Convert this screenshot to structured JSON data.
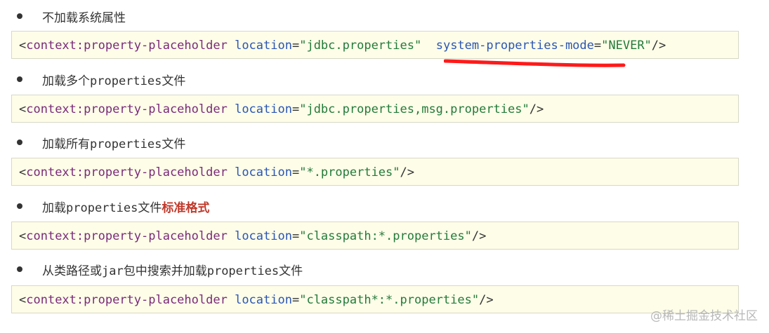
{
  "items": [
    {
      "bullet_parts": [
        {
          "text": "不加载系统属性",
          "mono": false
        }
      ],
      "code": {
        "open": "<",
        "tag": "context:property-placeholder",
        "attrs": [
          {
            "name": "location",
            "value": "\"jdbc.properties\""
          },
          {
            "name": "system-properties-mode",
            "value": "\"NEVER\""
          }
        ],
        "close": "/>"
      }
    },
    {
      "bullet_parts": [
        {
          "text": "加载多个",
          "mono": false
        },
        {
          "text": "properties",
          "mono": true
        },
        {
          "text": "文件",
          "mono": false
        }
      ],
      "code": {
        "open": "<",
        "tag": "context:property-placeholder",
        "attrs": [
          {
            "name": "location",
            "value": "\"jdbc.properties,msg.properties\""
          }
        ],
        "close": "/>"
      }
    },
    {
      "bullet_parts": [
        {
          "text": "加载所有",
          "mono": false
        },
        {
          "text": "properties",
          "mono": true
        },
        {
          "text": "文件",
          "mono": false
        }
      ],
      "code": {
        "open": "<",
        "tag": "context:property-placeholder",
        "attrs": [
          {
            "name": "location",
            "value": "\"*.properties\""
          }
        ],
        "close": "/>"
      }
    },
    {
      "bullet_parts": [
        {
          "text": "加载",
          "mono": false
        },
        {
          "text": "properties",
          "mono": true
        },
        {
          "text": "文件",
          "mono": false
        },
        {
          "text": "标准格式",
          "mono": false,
          "highlight": true
        }
      ],
      "code": {
        "open": "<",
        "tag": "context:property-placeholder",
        "attrs": [
          {
            "name": "location",
            "value": "\"classpath:*.properties\""
          }
        ],
        "close": "/>"
      }
    },
    {
      "bullet_parts": [
        {
          "text": "从类路径或",
          "mono": false
        },
        {
          "text": "jar",
          "mono": true
        },
        {
          "text": "包中搜索并加载",
          "mono": false
        },
        {
          "text": "properties",
          "mono": true
        },
        {
          "text": "文件",
          "mono": false
        }
      ],
      "code": {
        "open": "<",
        "tag": "context:property-placeholder",
        "attrs": [
          {
            "name": "location",
            "value": "\"classpath*:*.properties\""
          }
        ],
        "close": "/>"
      }
    }
  ],
  "watermark": "@稀土掘金技术社区",
  "colors": {
    "highlight": "#c0392b",
    "code_background": "#fdfde8",
    "tag": "#7a2a7a",
    "attr": "#2a55b5",
    "value": "#247a3a",
    "underline_mark": "#ff1a1a"
  }
}
